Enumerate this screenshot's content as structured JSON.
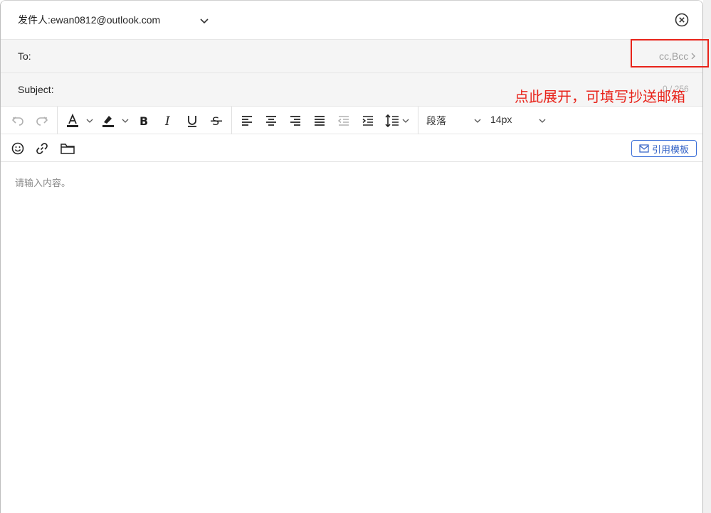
{
  "sender": {
    "label": "发件人:",
    "email": "ewan0812@outlook.com"
  },
  "to": {
    "label": "To:",
    "cc_bcc": "cc,Bcc"
  },
  "subject": {
    "label": "Subject:",
    "counter": "0 / 256"
  },
  "toolbar": {
    "paragraph": "段落",
    "font_size": "14px",
    "template_button": "引用模板"
  },
  "editor": {
    "placeholder": "请输入内容。"
  },
  "annotation": {
    "text": "点此展开，可填写抄送邮箱"
  },
  "colors": {
    "accent": "#2f5fc4",
    "highlight": "#e8231a",
    "field_bg": "#f5f5f5"
  }
}
